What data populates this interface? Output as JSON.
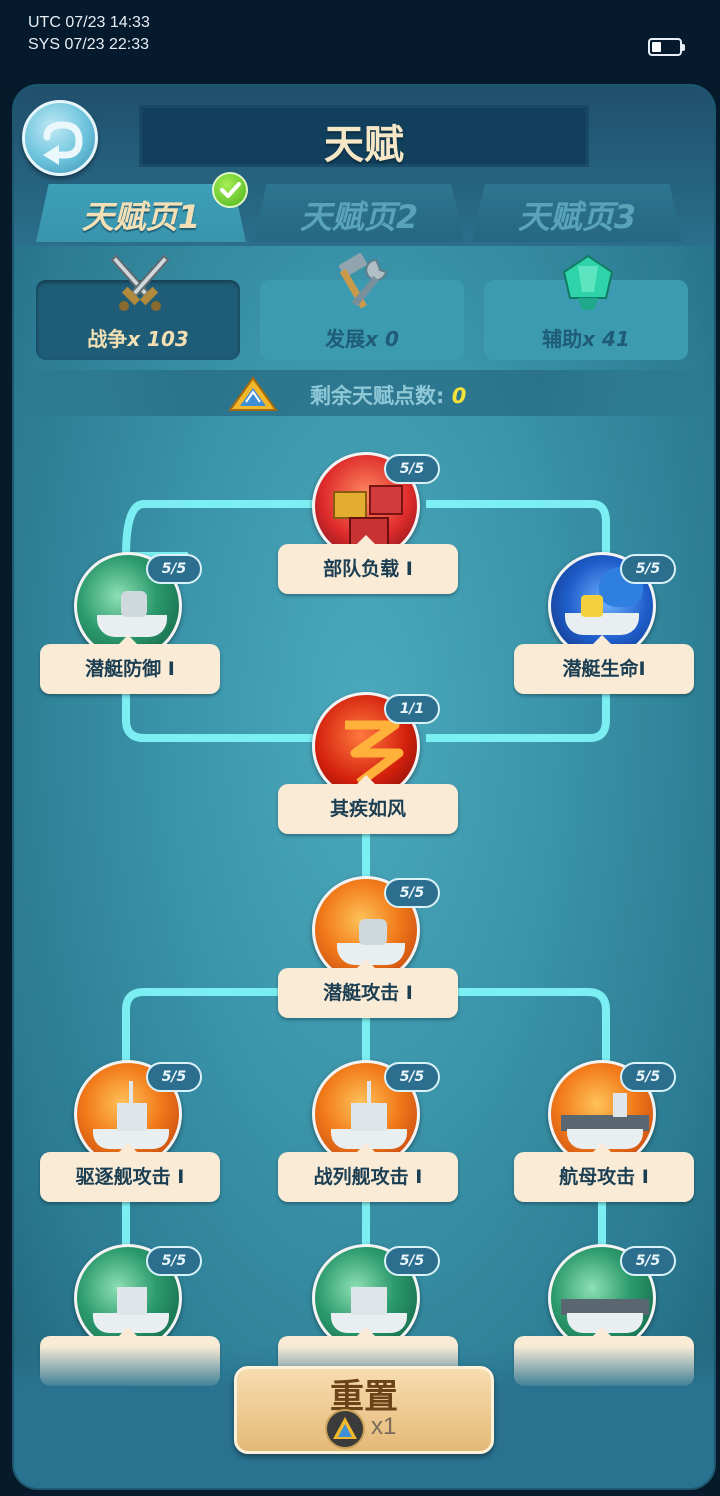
{
  "status": {
    "utc": "UTC 07/23 14:33",
    "sys": "SYS 07/23 22:33",
    "battery_level": 0.3
  },
  "header": {
    "title": "天赋"
  },
  "tabs": [
    {
      "label": "天赋页",
      "num": "1",
      "active": true
    },
    {
      "label": "天赋页",
      "num": "2",
      "active": false
    },
    {
      "label": "天赋页",
      "num": "3",
      "active": false
    }
  ],
  "categories": [
    {
      "label": "战争",
      "count": "x 103",
      "icon": "crossed-swords-icon",
      "active": true
    },
    {
      "label": "发展",
      "count": "x 0",
      "icon": "hammer-wrench-icon",
      "active": false
    },
    {
      "label": "辅助",
      "count": "x 41",
      "icon": "teal-gem-icon",
      "active": false
    }
  ],
  "points": {
    "label": "剩余天赋点数:",
    "value": "0"
  },
  "talents": [
    {
      "name": "部队负载 I",
      "level": "5/5"
    },
    {
      "name": "潜艇防御 I",
      "level": "5/5"
    },
    {
      "name": "潜艇生命I",
      "level": "5/5"
    },
    {
      "name": "其疾如风",
      "level": "1/1"
    },
    {
      "name": "潜艇攻击 I",
      "level": "5/5"
    },
    {
      "name": "驱逐舰攻击 I",
      "level": "5/5"
    },
    {
      "name": "战列舰攻击 I",
      "level": "5/5"
    },
    {
      "name": "航母攻击 I",
      "level": "5/5"
    },
    {
      "name": "",
      "level": "5/5"
    },
    {
      "name": "",
      "level": "5/5"
    },
    {
      "name": "",
      "level": "5/5"
    }
  ],
  "reset": {
    "label": "重置",
    "cost": "x1"
  },
  "colors": {
    "connector": "#7ff3f6",
    "accent_yellow": "#f5e23b",
    "plate": "#f9ebd6"
  }
}
